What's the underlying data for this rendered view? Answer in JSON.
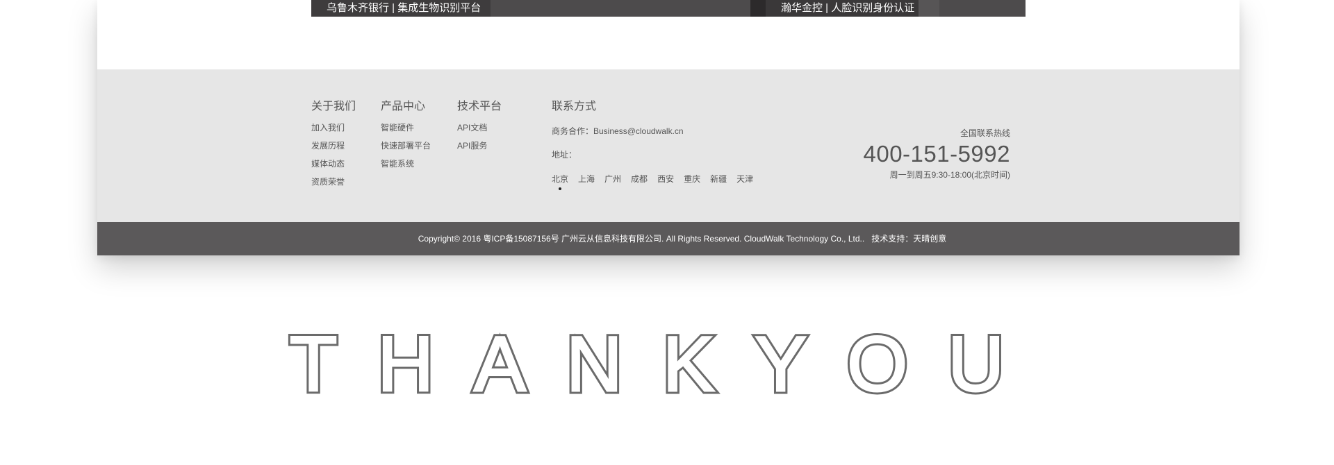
{
  "cases": {
    "left_caption": "乌鲁木齐银行 | 集成生物识别平台",
    "right_caption": "瀚华金控 | 人脸识别身份认证"
  },
  "footer": {
    "about": {
      "title": "关于我们",
      "items": [
        "加入我们",
        "发展历程",
        "媒体动态",
        "资质荣誉"
      ]
    },
    "product": {
      "title": "产品中心",
      "items": [
        "智能硬件",
        "快速部署平台",
        "智能系统"
      ]
    },
    "tech": {
      "title": "技术平台",
      "items": [
        "API文档",
        "API服务"
      ]
    },
    "contact": {
      "title": "联系方式",
      "business": "商务合作：Business@cloudwalk.cn",
      "address": "地址：",
      "cities": [
        "北京",
        "上海",
        "广州",
        "成都",
        "西安",
        "重庆",
        "新疆",
        "天津"
      ],
      "active_city": "北京"
    },
    "hotline": {
      "label": "全国联系热线",
      "number": "400-151-5992",
      "hours": "周一到周五9:30-18:00(北京时间)"
    }
  },
  "copyright": {
    "text": "Copyright© 2016 粤ICP备15087156号 广州云从信息科技有限公司. All Rights Reserved. CloudWalk Technology Co., Ltd..",
    "support": "技术支持：天晴创意"
  },
  "thankyou": "THANKYOU",
  "colors": {
    "footer_bg": "#e6e6e6",
    "copyright_bg": "#5b595a",
    "text": "#555555",
    "outline_text": "#6b6b6b"
  }
}
